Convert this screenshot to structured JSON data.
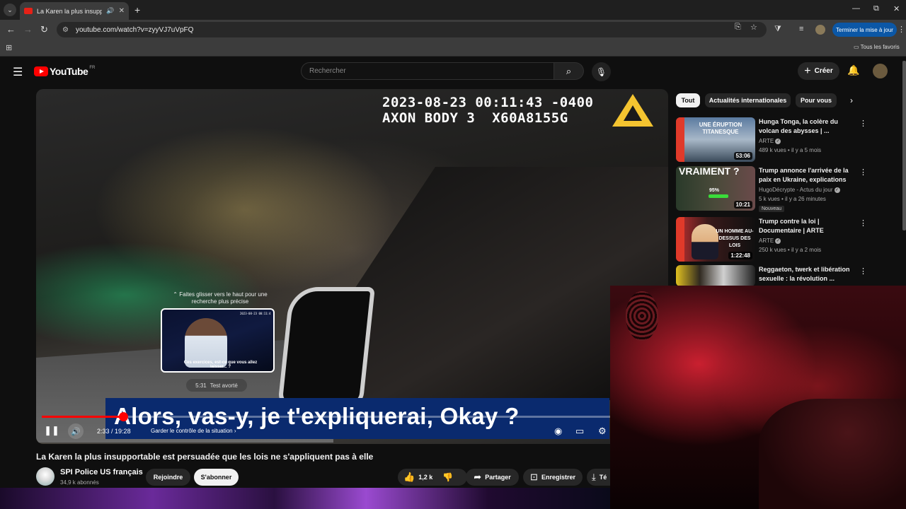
{
  "browser": {
    "tab_title": "La Karen la plus insupportal",
    "url": "youtube.com/watch?v=zyyVJ7uVpFQ",
    "update_button": "Terminer la mise à jour",
    "bookmarks_label": "Tous les favoris"
  },
  "header": {
    "logo_text": "YouTube",
    "logo_region": "FR",
    "search_placeholder": "Rechercher",
    "create_label": "Créer"
  },
  "player": {
    "cam_timestamp": "2023-08-23 00:11:43 -0400",
    "cam_model": "AXON BODY 3  X60A8155G",
    "swipe_hint": "⌃ Faites glisser vers le haut pour une recherche plus précise",
    "preview_caption": "Ces exercices, est-ce que vous allez laisser... ?",
    "preview_stamp": "2023-08-23 00:11:4",
    "preview_time": "5:31",
    "preview_chapter": "Test avorté",
    "subtitle": "Alors, vas-y, je t'expliquerai, Okay ?",
    "current_time": "2:33",
    "duration": "19:28",
    "time_separator": " / ",
    "chapter": "Garder le contrôle de la situation",
    "progress_fraction": 0.131
  },
  "video": {
    "title": "La Karen la plus insupportable est persuadée que les lois ne s'appliquent pas à elle",
    "channel_name": "SPI Police US français",
    "subscribers": "34,9 k abonnés",
    "join_label": "Rejoindre",
    "subscribe_label": "S'abonner",
    "likes": "1,2 k",
    "share_label": "Partager",
    "save_label": "Enregistrer",
    "download_label": "Té"
  },
  "sidebar": {
    "chips": [
      "Tout",
      "Actualités internationales",
      "Pour vous"
    ],
    "recommendations": [
      {
        "title": "Hunga Tonga, la colère du volcan des abysses | ...",
        "channel": "ARTE",
        "meta": "489 k vues • il y a 5 mois",
        "duration": "53:06",
        "thumb_text": "UNE ÉRUPTION TITANESQUE",
        "is_new": false
      },
      {
        "title": "Trump annonce l'arrivée de la paix en Ukraine, explications",
        "channel": "HugoDécrypte - Actus du jour",
        "meta": "5 k vues • il y a 26 minutes",
        "duration": "10:21",
        "thumb_text": "VRAIMENT ?",
        "thumb_percent": "95%",
        "is_new": true,
        "new_label": "Nouveau"
      },
      {
        "title": "Trump contre la loi | Documentaire | ARTE",
        "channel": "ARTE",
        "meta": "250 k vues • il y a 2 mois",
        "duration": "1:22:48",
        "thumb_text": "UN HOMME AU-DESSUS DES LOIS",
        "is_new": false
      },
      {
        "title": "Reggaeton, twerk et libération sexuelle :  la révolution ...",
        "channel": "",
        "meta": "",
        "duration": "",
        "thumb_text": "",
        "is_new": false
      }
    ]
  },
  "colors": {
    "youtube_red": "#ff0000",
    "update_blue": "#0b57a6",
    "caption_blue": "#0a2a6e"
  }
}
